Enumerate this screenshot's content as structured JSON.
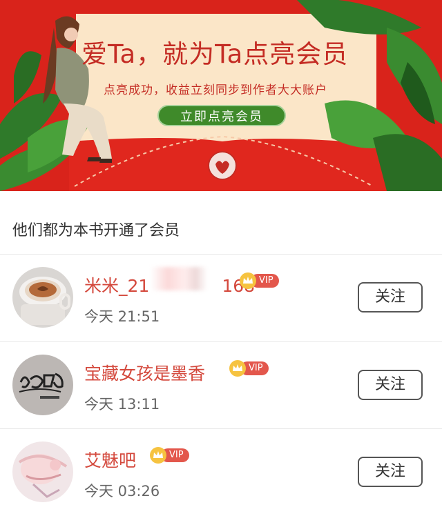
{
  "banner": {
    "headline": "爱Ta，就为Ta点亮会员",
    "subline": "点亮成功，收益立刻同步到作者大大账户",
    "cta_label": "立即点亮会员"
  },
  "section_title": "他们都为本书开通了会员",
  "members": [
    {
      "name": "米米_21",
      "name_suffix": "168",
      "badge": "VIP",
      "time": "今天 21:51",
      "follow_label": "关注"
    },
    {
      "name": "宝藏女孩是墨香",
      "name_suffix": "",
      "badge": "VIP",
      "time": "今天 13:11",
      "follow_label": "关注"
    },
    {
      "name": "艾魅吧",
      "name_suffix": "",
      "badge": "VIP",
      "time": "今天 03:26",
      "follow_label": "关注"
    }
  ],
  "colors": {
    "banner_red": "#d9231b",
    "card_cream": "#fbe6c8",
    "cta_green": "#3f8a2a",
    "name_red": "#d4493d",
    "vip_red": "#e3574c",
    "crown_gold": "#f6c340"
  }
}
